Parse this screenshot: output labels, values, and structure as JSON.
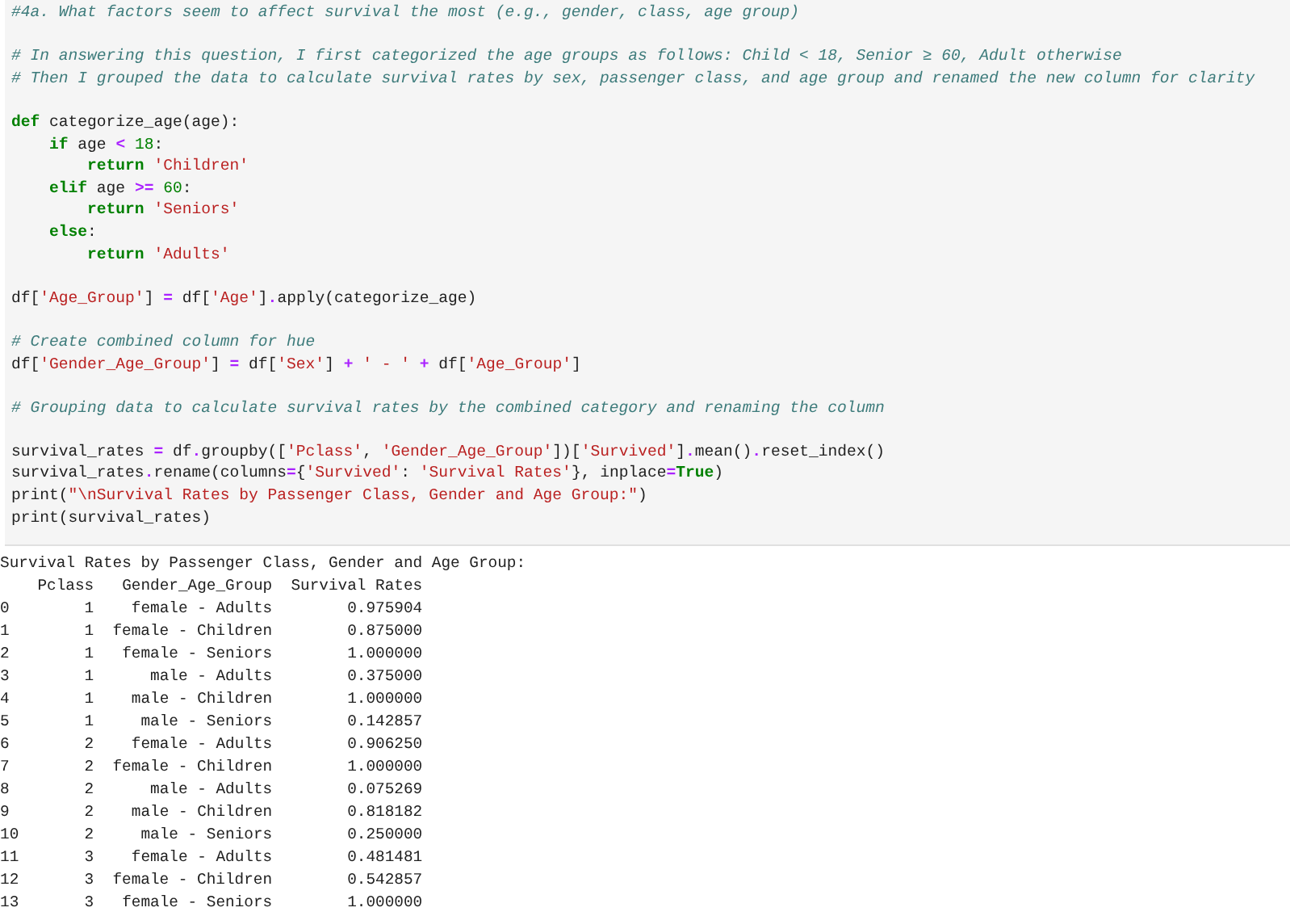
{
  "code_cell": {
    "blocks": [
      {
        "lines": [
          [
            {
              "kind": "comment",
              "text": "#4a. What factors seem to affect survival the most (e.g., gender, class, age group)"
            }
          ]
        ]
      },
      {
        "lines": [
          [
            {
              "kind": "comment",
              "text": "# In answering this question, I first categorized the age groups as follows: Child < 18, Senior ≥ 60, Adult otherwise"
            }
          ],
          [
            {
              "kind": "comment",
              "text": "# Then I grouped the data to calculate survival rates by sex, passenger class, and age group and renamed the new column for clarity"
            }
          ]
        ]
      },
      {
        "lines": [
          [
            {
              "kind": "keyword",
              "text": "def"
            },
            {
              "kind": "plain",
              "text": " categorize_age(age):"
            }
          ],
          [
            {
              "kind": "keyword",
              "text": "    if"
            },
            {
              "kind": "plain",
              "text": " age "
            },
            {
              "kind": "operator",
              "text": "<"
            },
            {
              "kind": "number",
              "text": " 18"
            },
            {
              "kind": "plain",
              "text": ":"
            }
          ],
          [
            {
              "kind": "keyword",
              "text": "        return"
            },
            {
              "kind": "string",
              "text": " 'Children'"
            }
          ],
          [
            {
              "kind": "keyword",
              "text": "    elif"
            },
            {
              "kind": "plain",
              "text": " age "
            },
            {
              "kind": "operator",
              "text": ">="
            },
            {
              "kind": "number",
              "text": " 60"
            },
            {
              "kind": "plain",
              "text": ":"
            }
          ],
          [
            {
              "kind": "keyword",
              "text": "        return"
            },
            {
              "kind": "string",
              "text": " 'Seniors'"
            }
          ],
          [
            {
              "kind": "keyword",
              "text": "    else"
            },
            {
              "kind": "plain",
              "text": ":"
            }
          ],
          [
            {
              "kind": "keyword",
              "text": "        return"
            },
            {
              "kind": "string",
              "text": " 'Adults'"
            }
          ]
        ]
      },
      {
        "lines": [
          [
            {
              "kind": "plain",
              "text": "df["
            },
            {
              "kind": "string",
              "text": "'Age_Group'"
            },
            {
              "kind": "plain",
              "text": "] "
            },
            {
              "kind": "operator",
              "text": "="
            },
            {
              "kind": "plain",
              "text": " df["
            },
            {
              "kind": "string",
              "text": "'Age'"
            },
            {
              "kind": "plain",
              "text": "]"
            },
            {
              "kind": "operator",
              "text": "."
            },
            {
              "kind": "plain",
              "text": "apply(categorize_age)"
            }
          ]
        ]
      },
      {
        "lines": [
          [
            {
              "kind": "comment",
              "text": "# Create combined column for hue"
            }
          ],
          [
            {
              "kind": "plain",
              "text": "df["
            },
            {
              "kind": "string",
              "text": "'Gender_Age_Group'"
            },
            {
              "kind": "plain",
              "text": "] "
            },
            {
              "kind": "operator",
              "text": "="
            },
            {
              "kind": "plain",
              "text": " df["
            },
            {
              "kind": "string",
              "text": "'Sex'"
            },
            {
              "kind": "plain",
              "text": "] "
            },
            {
              "kind": "operator",
              "text": "+"
            },
            {
              "kind": "string",
              "text": " ' - '"
            },
            {
              "kind": "operator",
              "text": " +"
            },
            {
              "kind": "plain",
              "text": " df["
            },
            {
              "kind": "string",
              "text": "'Age_Group'"
            },
            {
              "kind": "plain",
              "text": "]"
            }
          ]
        ]
      },
      {
        "lines": [
          [
            {
              "kind": "comment",
              "text": "# Grouping data to calculate survival rates by the combined category and renaming the column"
            }
          ]
        ]
      },
      {
        "lines": [
          [
            {
              "kind": "plain",
              "text": "survival_rates "
            },
            {
              "kind": "operator",
              "text": "="
            },
            {
              "kind": "plain",
              "text": " df"
            },
            {
              "kind": "operator",
              "text": "."
            },
            {
              "kind": "plain",
              "text": "groupby(["
            },
            {
              "kind": "string",
              "text": "'Pclass'"
            },
            {
              "kind": "plain",
              "text": ", "
            },
            {
              "kind": "string",
              "text": "'Gender_Age_Group'"
            },
            {
              "kind": "plain",
              "text": "])["
            },
            {
              "kind": "string",
              "text": "'Survived'"
            },
            {
              "kind": "plain",
              "text": "]"
            },
            {
              "kind": "operator",
              "text": "."
            },
            {
              "kind": "plain",
              "text": "mean()"
            },
            {
              "kind": "operator",
              "text": "."
            },
            {
              "kind": "plain",
              "text": "reset_index()"
            }
          ],
          [
            {
              "kind": "plain",
              "text": "survival_rates"
            },
            {
              "kind": "operator",
              "text": "."
            },
            {
              "kind": "plain",
              "text": "rename(columns"
            },
            {
              "kind": "operator",
              "text": "="
            },
            {
              "kind": "plain",
              "text": "{"
            },
            {
              "kind": "string",
              "text": "'Survived'"
            },
            {
              "kind": "plain",
              "text": ": "
            },
            {
              "kind": "string",
              "text": "'Survival Rates'"
            },
            {
              "kind": "plain",
              "text": "}, inplace"
            },
            {
              "kind": "operator",
              "text": "="
            },
            {
              "kind": "keyword",
              "text": "True"
            },
            {
              "kind": "plain",
              "text": ")"
            }
          ],
          [
            {
              "kind": "plain",
              "text": "print("
            },
            {
              "kind": "string",
              "text": "\"\\nSurvival Rates by Passenger Class, Gender and Age Group:\""
            },
            {
              "kind": "plain",
              "text": ")"
            }
          ],
          [
            {
              "kind": "plain",
              "text": "print(survival_rates)"
            }
          ]
        ]
      }
    ]
  },
  "output": {
    "title": "Survival Rates by Passenger Class, Gender and Age Group:",
    "columns": [
      "Pclass",
      "Gender_Age_Group",
      "Survival Rates"
    ],
    "rows": [
      {
        "index": "0",
        "pclass": "1",
        "group": "female - Adults",
        "rate": "0.975904"
      },
      {
        "index": "1",
        "pclass": "1",
        "group": "female - Children",
        "rate": "0.875000"
      },
      {
        "index": "2",
        "pclass": "1",
        "group": "female - Seniors",
        "rate": "1.000000"
      },
      {
        "index": "3",
        "pclass": "1",
        "group": "male - Adults",
        "rate": "0.375000"
      },
      {
        "index": "4",
        "pclass": "1",
        "group": "male - Children",
        "rate": "1.000000"
      },
      {
        "index": "5",
        "pclass": "1",
        "group": "male - Seniors",
        "rate": "0.142857"
      },
      {
        "index": "6",
        "pclass": "2",
        "group": "female - Adults",
        "rate": "0.906250"
      },
      {
        "index": "7",
        "pclass": "2",
        "group": "female - Children",
        "rate": "1.000000"
      },
      {
        "index": "8",
        "pclass": "2",
        "group": "male - Adults",
        "rate": "0.075269"
      },
      {
        "index": "9",
        "pclass": "2",
        "group": "male - Children",
        "rate": "0.818182"
      },
      {
        "index": "10",
        "pclass": "2",
        "group": "male - Seniors",
        "rate": "0.250000"
      },
      {
        "index": "11",
        "pclass": "3",
        "group": "female - Adults",
        "rate": "0.481481"
      },
      {
        "index": "12",
        "pclass": "3",
        "group": "female - Children",
        "rate": "0.542857"
      },
      {
        "index": "13",
        "pclass": "3",
        "group": "female - Seniors",
        "rate": "1.000000"
      }
    ]
  }
}
